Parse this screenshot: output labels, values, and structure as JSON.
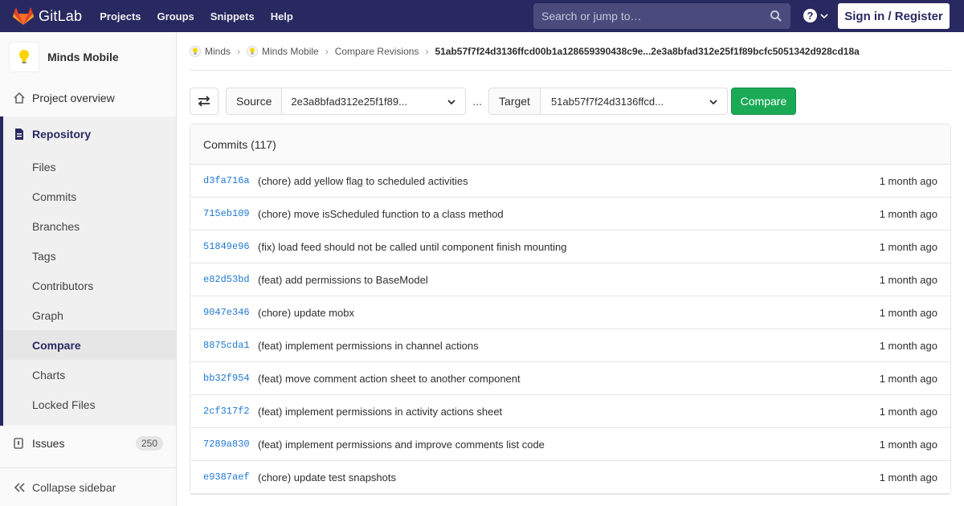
{
  "navbar": {
    "brand": "GitLab",
    "links": [
      "Projects",
      "Groups",
      "Snippets",
      "Help"
    ],
    "search_placeholder": "Search or jump to…",
    "help_label": "?",
    "signin": "Sign in / Register",
    "colors": {
      "bg": "#292961",
      "search_bg": "#4a4a7d"
    }
  },
  "sidebar": {
    "project_name": "Minds Mobile",
    "overview": "Project overview",
    "repository": "Repository",
    "repo_items": [
      "Files",
      "Commits",
      "Branches",
      "Tags",
      "Contributors",
      "Graph",
      "Compare",
      "Charts",
      "Locked Files"
    ],
    "active_item": "Compare",
    "issues": "Issues",
    "issues_count": "250",
    "collapse": "Collapse sidebar"
  },
  "breadcrumb": {
    "items": [
      "Minds",
      "Minds Mobile",
      "Compare Revisions"
    ],
    "current": "51ab57f7f24d3136ffcd00b1a128659390438c9e...2e3a8bfad312e25f1f89bcfc5051342d928cd18a"
  },
  "compare": {
    "source_label": "Source",
    "source_value": "2e3a8bfad312e25f1f89...",
    "ellipsis": "...",
    "target_label": "Target",
    "target_value": "51ab57f7f24d3136ffcd...",
    "button": "Compare",
    "button_color": "#1aaa55"
  },
  "commits": {
    "header": "Commits (117)",
    "rows": [
      {
        "sha": "d3fa716a",
        "message": "(chore) add yellow flag to scheduled activities",
        "time": "1 month ago"
      },
      {
        "sha": "715eb109",
        "message": "(chore) move isScheduled function to a class method",
        "time": "1 month ago"
      },
      {
        "sha": "51849e96",
        "message": "(fix) load feed should not be called until component finish mounting",
        "time": "1 month ago"
      },
      {
        "sha": "e82d53bd",
        "message": "(feat) add permissions to BaseModel",
        "time": "1 month ago"
      },
      {
        "sha": "9047e346",
        "message": "(chore) update mobx",
        "time": "1 month ago"
      },
      {
        "sha": "8875cda1",
        "message": "(feat) implement permissions in channel actions",
        "time": "1 month ago"
      },
      {
        "sha": "bb32f954",
        "message": "(feat) move comment action sheet to another component",
        "time": "1 month ago"
      },
      {
        "sha": "2cf317f2",
        "message": "(feat) implement permissions in activity actions sheet",
        "time": "1 month ago"
      },
      {
        "sha": "7289a830",
        "message": "(feat) implement permissions and improve comments list code",
        "time": "1 month ago"
      },
      {
        "sha": "e9387aef",
        "message": "(chore) update test snapshots",
        "time": "1 month ago"
      }
    ]
  }
}
